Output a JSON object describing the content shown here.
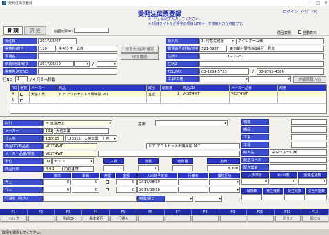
{
  "window": {
    "title": "受発注伝票登録",
    "minimize": "—",
    "maximize": "□",
    "close": "✕"
  },
  "header": {
    "title": "受発注伝票登録",
    "note1": "※ 「*」は必ず入力してください。",
    "note2": "※ 項目タイトルが青字の項目はF6キーで検索入力が可能です。",
    "login_label": "ログイン",
    "login_user": "ｲﾄｳｼﾞ ｲﾄｳ"
  },
  "tabs": {
    "new": "新規",
    "change": "変更"
  },
  "top": {
    "slip_no_label": "前回伝票NO",
    "prev_label": "前回表題",
    "auto_label": "自動表示",
    "order_date_label": "受注日",
    "order_date": "2017/08/07",
    "customer_label": "得意先/担当",
    "customer_code": "110",
    "customer_name": "ネギシホーム㈱",
    "site_label": "現場名",
    "term_label": "納期/時間/曜日",
    "term_date": "2017/08/10",
    "term_sep": "/",
    "workname_label": "得意先注文NO",
    "btn_customer": "得意先/住所 確定",
    "btn_site": "現場履歴",
    "delivery_label": "納入先",
    "delivery_type": "1: 得意先現場",
    "delivery_name": "ネギシホーム㈱",
    "postal_label": "郵便番号/住所/地名",
    "postal": "321-0987",
    "address1": "東京都台野市栃1番区上見北",
    "address_label": "住所1",
    "address2": "1－2－52",
    "address2_label": "住所2",
    "tel_label": "TEL/FAX",
    "tel": "03-1234-5723",
    "fax": "03-8765-4366",
    "fax_sep": "/",
    "work_label": "工事/工種",
    "detail_btn": "詳細情報入力"
  },
  "row_info": {
    "label": "行NO",
    "value": "1",
    "pager": "/ 4 行目へ移動"
  },
  "grid": {
    "headers": [
      "NO",
      "選択",
      "メーカー",
      "商品",
      "取引",
      "総数量",
      "商品CD",
      "メーカー品番",
      "規格"
    ],
    "rows": [
      [
        "4",
        "",
        "大信工業",
        "ドア アウトセット出隅半開 ＭＴ",
        "直送",
        "1",
        "VC2T4WT",
        "VC2T4WT",
        ""
      ],
      [
        "5",
        "",
        "",
        "",
        "",
        "",
        "",
        "",
        ""
      ]
    ]
  },
  "detail": {
    "kind_label": "取引",
    "kind": "3: 直送売上",
    "warehouse_label": "倉庫",
    "maker_label": "メーカー",
    "maker_code": "101",
    "maker_name": "大信工業",
    "supplier_label": "仕入先",
    "supplier_code": "130015",
    "supplier_name": "130015：大信工業（上吉）",
    "code_label": "商品CD/商品名",
    "code": "VC2T4WT",
    "product_name": "ドア アウトセット出隅半開 ＭＴ",
    "makerno_label": "メーカー品番/規格",
    "makerno": "VC2T4WT",
    "cat_label": "単位",
    "cat": "09",
    "cat_name": "セット",
    "qty_label": "入数",
    "qty": "1",
    "count_label": "数量",
    "count": "1",
    "total_label": "総数量",
    "total": "1",
    "price_label": "定価",
    "price": "8,300",
    "cls_label": "商品分類",
    "cls": "4 9 1",
    "cls_name": "内装建材"
  },
  "amount": {
    "headers": [
      "掛率",
      "単価",
      "金額",
      "無償",
      "入出荷予定日",
      "行備考",
      "課税区分"
    ],
    "sale_label": "売上",
    "sale_rate": "0",
    "sale_price": "0",
    "sale_amount": "0",
    "sale_date": "2017/08/10",
    "buy_label": "仕入",
    "buy_rate": "0",
    "buy_price": "0",
    "buy_amount": "0",
    "buy_date": "2017/08/10",
    "memo_label": "行備考（社内）",
    "timer_label": "時間/曜日"
  },
  "rpanel": {
    "l1": "構造",
    "l2": "搬品",
    "l3": "工事",
    "l4": "工程",
    "l5": "納入先",
    "l5v": "ネギシホーム㈱",
    "l6": "配送コース",
    "l7": "配送業者",
    "h1": [
      "入出単价",
      "ｷｬﾝｾﾙ数",
      "受発注残数"
    ],
    "v1": [
      "0",
      "0",
      "0"
    ],
    "h2": [
      "出荷数",
      "発注残数",
      "受注残数",
      "引当可能数"
    ],
    "v2": [
      "",
      "",
      "",
      ""
    ]
  },
  "fkeys": [
    "F1",
    "F2",
    "F3",
    "F4",
    "F5",
    "F6",
    "F7",
    "F8",
    "F9",
    "F10",
    "F11",
    "F12"
  ],
  "fbtns": [
    "ヘルプ",
    "",
    "明細OK",
    "構成変更",
    "行挿入",
    "",
    "",
    "",
    "",
    "",
    "クリア",
    "閉じる"
  ],
  "status": "取引を選択してください。"
}
